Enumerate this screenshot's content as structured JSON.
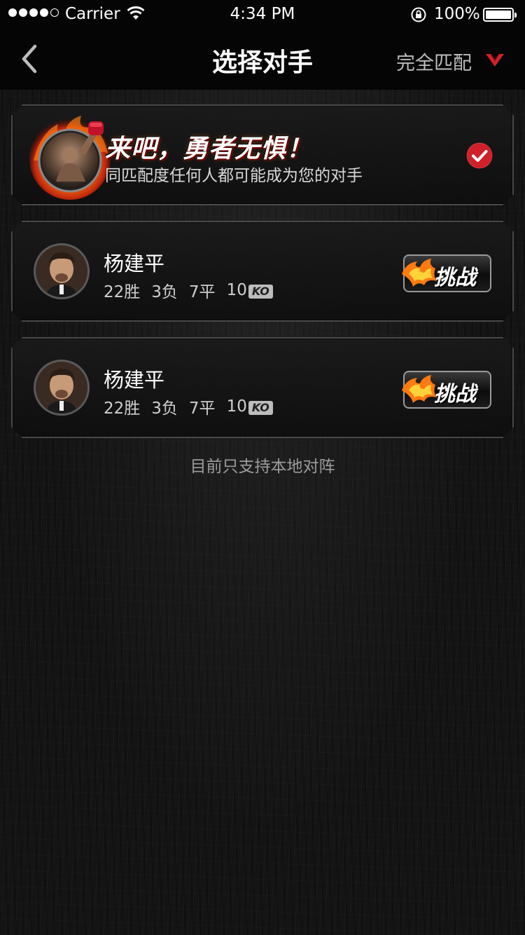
{
  "status_bar": {
    "carrier": "Carrier",
    "time": "4:34 PM",
    "battery": "100%",
    "signal_bars": 4
  },
  "nav": {
    "title": "选择对手",
    "filter_label": "完全匹配",
    "accent_color": "#d0202a"
  },
  "banner": {
    "slogan": "来吧，勇者无惧！",
    "subtitle": "同匹配度任何人都可能成为您的对手",
    "selected": true
  },
  "opponents": [
    {
      "name": "杨建平",
      "wins": "22胜",
      "losses": "3负",
      "draws": "7平",
      "ko_count": "10",
      "ko_label": "KO",
      "action_label": "挑战"
    },
    {
      "name": "杨建平",
      "wins": "22胜",
      "losses": "3负",
      "draws": "7平",
      "ko_count": "10",
      "ko_label": "KO",
      "action_label": "挑战"
    }
  ],
  "footer_note": "目前只支持本地对阵"
}
